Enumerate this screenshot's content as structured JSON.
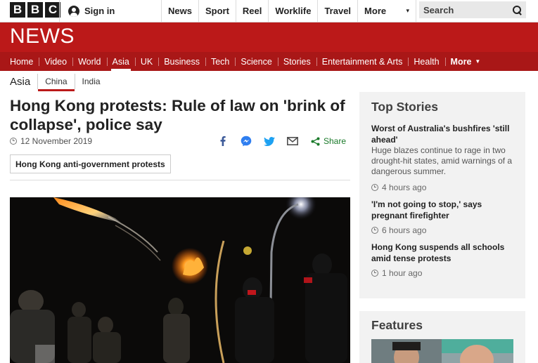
{
  "masthead": {
    "logo_letters": [
      "B",
      "B",
      "C"
    ],
    "signin_label": "Sign in",
    "nav": [
      "News",
      "Sport",
      "Reel",
      "Worklife",
      "Travel",
      "More"
    ],
    "search_placeholder": "Search"
  },
  "banner": {
    "wordmark": "NEWS"
  },
  "section_nav": {
    "items": [
      "Home",
      "Video",
      "World",
      "Asia",
      "UK",
      "Business",
      "Tech",
      "Science",
      "Stories",
      "Entertainment & Arts",
      "Health"
    ],
    "active": "Asia",
    "more_label": "More"
  },
  "subnav": {
    "root": "Asia",
    "items": [
      "China",
      "India"
    ],
    "active": "China"
  },
  "article": {
    "headline": "Hong Kong protests: Rule of law on 'brink of collapse', police say",
    "date": "12 November 2019",
    "share_label": "Share",
    "tag": "Hong Kong anti-government protests"
  },
  "top_stories": {
    "title": "Top Stories",
    "items": [
      {
        "title": "Worst of Australia's bushfires 'still ahead'",
        "summary": "Huge blazes continue to rage in two drought-hit states, amid warnings of a dangerous summer.",
        "time": "4 hours ago"
      },
      {
        "title": "'I'm not going to stop,' says pregnant firefighter",
        "summary": "",
        "time": "6 hours ago"
      },
      {
        "title": "Hong Kong suspends all schools amid tense protests",
        "summary": "",
        "time": "1 hour ago"
      }
    ]
  },
  "features": {
    "title": "Features"
  },
  "colors": {
    "brand_red": "#bb1919",
    "nav_red": "#a91717",
    "share_green": "#1a7a2a",
    "panel_grey": "#f2f2f2"
  }
}
